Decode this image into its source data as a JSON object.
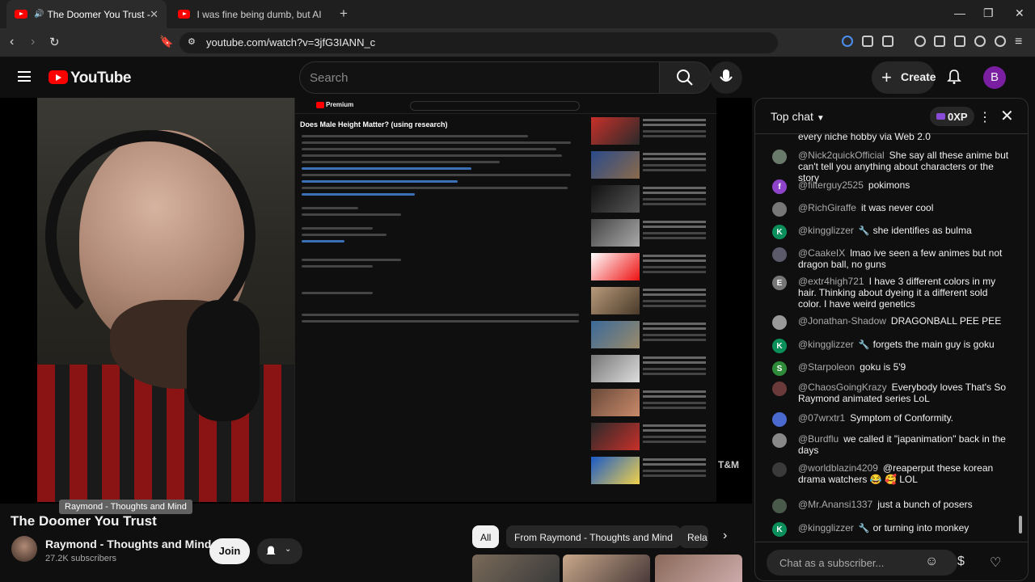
{
  "browser": {
    "tabs": [
      {
        "title": "The Doomer You Trust - YouTube",
        "active": true
      },
      {
        "title": "I was fine being dumb, but AI change",
        "active": false
      }
    ],
    "url": "youtube.com/watch?v=3jfG3IANN_c"
  },
  "youtube": {
    "logo": "YouTube",
    "search_placeholder": "Search",
    "create_label": "Create",
    "account_initial": "B"
  },
  "video": {
    "title": "The Doomer You Trust",
    "tooltip": "Raymond - Thoughts and Mind",
    "channel": "Raymond - Thoughts and Mind",
    "subscribers": "27.2K subscribers",
    "join_label": "Join",
    "watermark": "THOUGHTS T&M AND MIND"
  },
  "screen_content": {
    "mini_title": "Does Male Height Matter? (using research)",
    "mini_brand": "Premium"
  },
  "chips": [
    "All",
    "From Raymond - Thoughts and Mind",
    "Rela"
  ],
  "chat": {
    "header": "Top chat",
    "xp": "0XP",
    "input_placeholder": "Chat as a subscriber...",
    "messages": [
      {
        "author": "",
        "text": "every niche hobby via Web 2.0",
        "avatar": "",
        "color": "#555"
      },
      {
        "author": "@Nick2quickOfficial",
        "text": "She say all these anime but can't tell you anything about characters or the story",
        "avatar": "",
        "color": "#6a7a6a"
      },
      {
        "author": "@filterguy2525",
        "text": "pokimons",
        "avatar": "f",
        "color": "#8e44c9"
      },
      {
        "author": "@RichGiraffe",
        "text": "it was never cool",
        "avatar": "",
        "color": "#777"
      },
      {
        "author": "@kingglizzer",
        "text": "she identifies as bulma",
        "avatar": "K",
        "color": "#0a8f5a",
        "mod": true
      },
      {
        "author": "@CaakeIX",
        "text": "lmao ive seen a few animes but not dragon ball, no guns",
        "avatar": "",
        "color": "#5a5a6a"
      },
      {
        "author": "@extr4high721",
        "text": "I have 3 different colors in my hair. Thinking about dyeing it a different sold color. I have weird genetics",
        "avatar": "E",
        "color": "#777"
      },
      {
        "author": "@Jonathan-Shadow",
        "text": "DRAGONBALL PEE PEE",
        "avatar": "",
        "color": "#999"
      },
      {
        "author": "@kingglizzer",
        "text": "forgets the main guy is goku",
        "avatar": "K",
        "color": "#0a8f5a",
        "mod": true
      },
      {
        "author": "@Starpoleon",
        "text": "goku is 5'9",
        "avatar": "S",
        "color": "#2e8b3a"
      },
      {
        "author": "@ChaosGoingKrazy",
        "text": "Everybody loves That's So Raymond animated series LoL",
        "avatar": "",
        "color": "#6a3a3a"
      },
      {
        "author": "@07wrxtr1",
        "text": "Symptom of Conformity.",
        "avatar": "",
        "color": "#4a6ad0"
      },
      {
        "author": "@Burdflu",
        "text": "we called it \"japanimation\" back in the days",
        "avatar": "",
        "color": "#888"
      },
      {
        "author": "@worldblazin4209",
        "text": "@reaperput these korean drama watchers 😂 🥰 LOL",
        "avatar": "",
        "color": "#3a3a3a"
      },
      {
        "author": "@Mr.Anansi1337",
        "text": "just a bunch of posers",
        "avatar": "",
        "color": "#4a5a4a"
      },
      {
        "author": "@kingglizzer",
        "text": "or turning into monkey",
        "avatar": "K",
        "color": "#0a8f5a",
        "mod": true
      }
    ]
  }
}
